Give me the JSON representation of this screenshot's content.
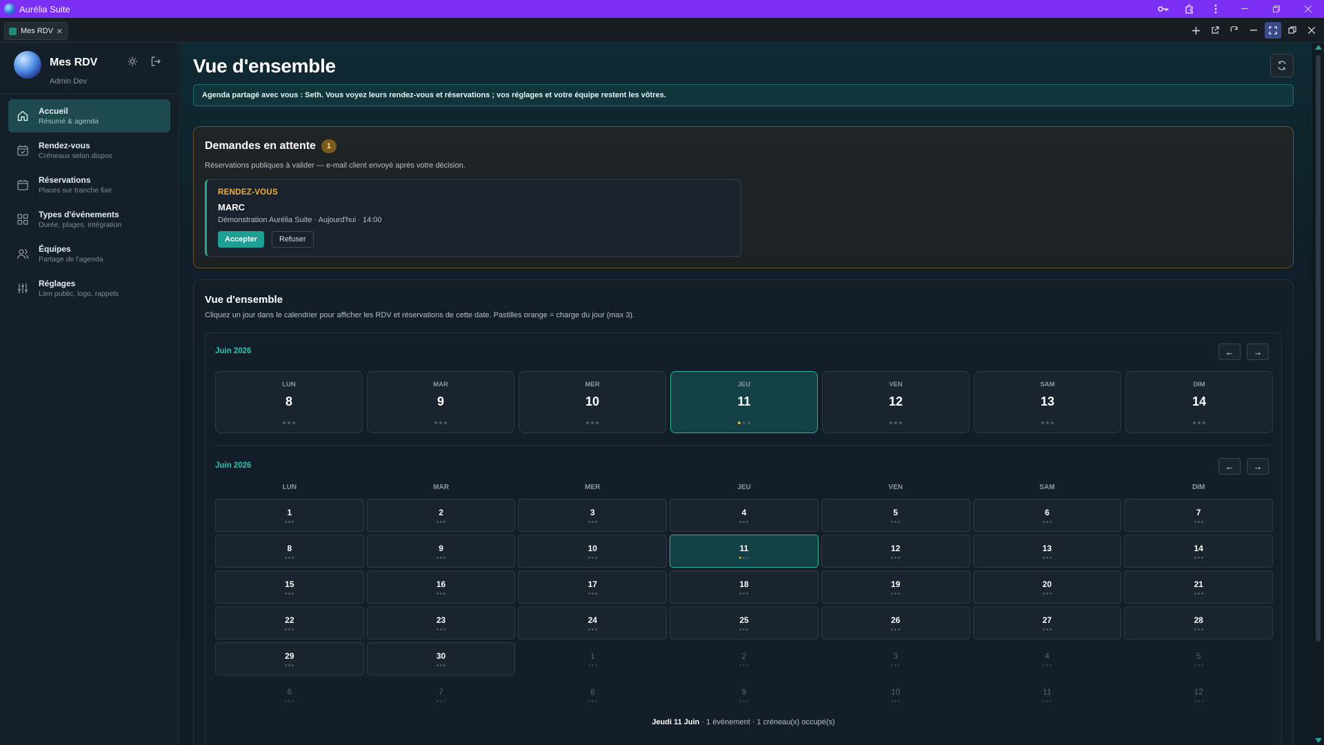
{
  "window": {
    "title": "Aurélia Suite"
  },
  "tab": {
    "label": "Mes RDV"
  },
  "sidebar": {
    "title": "Mes RDV",
    "subtitle": "Admin Dev",
    "items": [
      {
        "label": "Accueil",
        "sub": "Résumé & agenda",
        "icon": "home-icon",
        "active": true
      },
      {
        "label": "Rendez-vous",
        "sub": "Créneaux selon dispos",
        "icon": "calendar-check-icon",
        "active": false
      },
      {
        "label": "Réservations",
        "sub": "Places sur tranche fixe",
        "icon": "calendar-icon",
        "active": false
      },
      {
        "label": "Types d'événements",
        "sub": "Durée, plages, intégration",
        "icon": "grid-icon",
        "active": false
      },
      {
        "label": "Équipes",
        "sub": "Partage de l'agenda",
        "icon": "users-icon",
        "active": false
      },
      {
        "label": "Réglages",
        "sub": "Lien public, logo, rappels",
        "icon": "sliders-icon",
        "active": false
      }
    ]
  },
  "main": {
    "title": "Vue d'ensemble",
    "banner": "Agenda partagé avec vous : Seth. Vous voyez leurs rendez-vous et réservations ; vos réglages et votre équipe restent les vôtres."
  },
  "pending": {
    "title": "Demandes en attente",
    "count": "1",
    "subtitle": "Réservations publiques à valider — e-mail client envoyé après votre décision.",
    "request": {
      "type": "RENDEZ-VOUS",
      "name": "MARC",
      "detail": "Démonstration Aurélia Suite · Aujourd'hui · 14:00",
      "accept": "Accepter",
      "refuse": "Refuser"
    }
  },
  "overview": {
    "title": "Vue d'ensemble",
    "subtitle": "Cliquez un jour dans le calendrier pour afficher les RDV et réservations de cette date. Pastilles orange = charge du jour (max 3).",
    "week": {
      "month_label": "Juin 2026",
      "prev": "←",
      "next": "→",
      "days": [
        {
          "name": "LUN",
          "num": "8",
          "load": 0
        },
        {
          "name": "MAR",
          "num": "9",
          "load": 0
        },
        {
          "name": "MER",
          "num": "10",
          "load": 0
        },
        {
          "name": "JEU",
          "num": "11",
          "load": 1,
          "today": true
        },
        {
          "name": "VEN",
          "num": "12",
          "load": 0
        },
        {
          "name": "SAM",
          "num": "13",
          "load": 0
        },
        {
          "name": "DIM",
          "num": "14",
          "load": 0
        }
      ]
    },
    "month": {
      "month_label": "Juin 2026",
      "prev": "←",
      "next": "→",
      "dow": [
        "LUN",
        "MAR",
        "MER",
        "JEU",
        "VEN",
        "SAM",
        "DIM"
      ],
      "cells": [
        {
          "n": "1",
          "in": true
        },
        {
          "n": "2",
          "in": true
        },
        {
          "n": "3",
          "in": true
        },
        {
          "n": "4",
          "in": true
        },
        {
          "n": "5",
          "in": true
        },
        {
          "n": "6",
          "in": true
        },
        {
          "n": "7",
          "in": true
        },
        {
          "n": "8",
          "in": true
        },
        {
          "n": "9",
          "in": true
        },
        {
          "n": "10",
          "in": true
        },
        {
          "n": "11",
          "in": true,
          "today": true,
          "load": 1
        },
        {
          "n": "12",
          "in": true
        },
        {
          "n": "13",
          "in": true
        },
        {
          "n": "14",
          "in": true
        },
        {
          "n": "15",
          "in": true
        },
        {
          "n": "16",
          "in": true
        },
        {
          "n": "17",
          "in": true
        },
        {
          "n": "18",
          "in": true
        },
        {
          "n": "19",
          "in": true
        },
        {
          "n": "20",
          "in": true
        },
        {
          "n": "21",
          "in": true
        },
        {
          "n": "22",
          "in": true
        },
        {
          "n": "23",
          "in": true
        },
        {
          "n": "24",
          "in": true
        },
        {
          "n": "25",
          "in": true
        },
        {
          "n": "26",
          "in": true
        },
        {
          "n": "27",
          "in": true
        },
        {
          "n": "28",
          "in": true
        },
        {
          "n": "29",
          "in": true
        },
        {
          "n": "30",
          "in": true
        },
        {
          "n": "1",
          "in": false
        },
        {
          "n": "2",
          "in": false
        },
        {
          "n": "3",
          "in": false
        },
        {
          "n": "4",
          "in": false
        },
        {
          "n": "5",
          "in": false
        },
        {
          "n": "6",
          "in": false
        },
        {
          "n": "7",
          "in": false
        },
        {
          "n": "8",
          "in": false
        },
        {
          "n": "9",
          "in": false
        },
        {
          "n": "10",
          "in": false
        },
        {
          "n": "11",
          "in": false
        },
        {
          "n": "12",
          "in": false
        }
      ]
    },
    "footer": {
      "date": "Jeudi 11 Juin",
      "rest": " · 1 événement · 1 créneau(x) occupé(s)"
    }
  },
  "colors": {
    "titlebar": "#7b2ff2",
    "accent": "#1f9f93",
    "load_dot": "#f2b233",
    "pending_border": "#6b5426"
  }
}
